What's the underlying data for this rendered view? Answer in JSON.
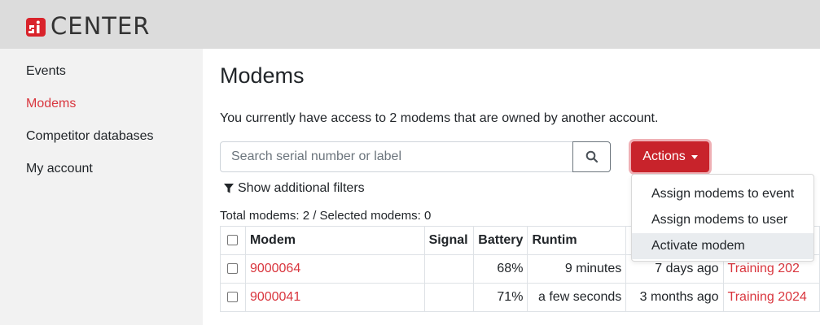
{
  "header": {
    "logo_text": "CENTER",
    "logo_mark": "si"
  },
  "sidebar": {
    "items": [
      {
        "label": "Events",
        "active": false
      },
      {
        "label": "Modems",
        "active": true
      },
      {
        "label": "Competitor databases",
        "active": false
      },
      {
        "label": "My account",
        "active": false
      }
    ]
  },
  "main": {
    "title": "Modems",
    "access_text": "You currently have access to 2 modems that are owned by another account.",
    "search": {
      "placeholder": "Search serial number or label",
      "value": "",
      "button_icon": "search-icon"
    },
    "actions_label": "Actions",
    "filters_label": "Show additional filters",
    "totals_text": "Total modems: 2 / Selected modems: 0",
    "table": {
      "headers": {
        "modem": "Modem",
        "signal": "Signal",
        "battery": "Battery",
        "runtime": "Runtim",
        "last_seen": "",
        "event": ""
      },
      "rows": [
        {
          "modem": "9000064",
          "signal": "",
          "battery": "68%",
          "runtime": "9 minutes",
          "last_seen": "7 days ago",
          "event": "Training 202"
        },
        {
          "modem": "9000041",
          "signal": "",
          "battery": "71%",
          "runtime": "a few seconds",
          "last_seen": "3 months ago",
          "event": "Training 2024"
        }
      ]
    },
    "dropdown": {
      "items": [
        {
          "label": "Assign modems to event"
        },
        {
          "label": "Assign modems to user"
        },
        {
          "label": "Activate modem"
        }
      ]
    }
  },
  "colors": {
    "accent": "#d9363e",
    "button": "#c8232b",
    "header_bg": "#dcdcdc",
    "sidebar_bg": "#f2f2f2"
  }
}
